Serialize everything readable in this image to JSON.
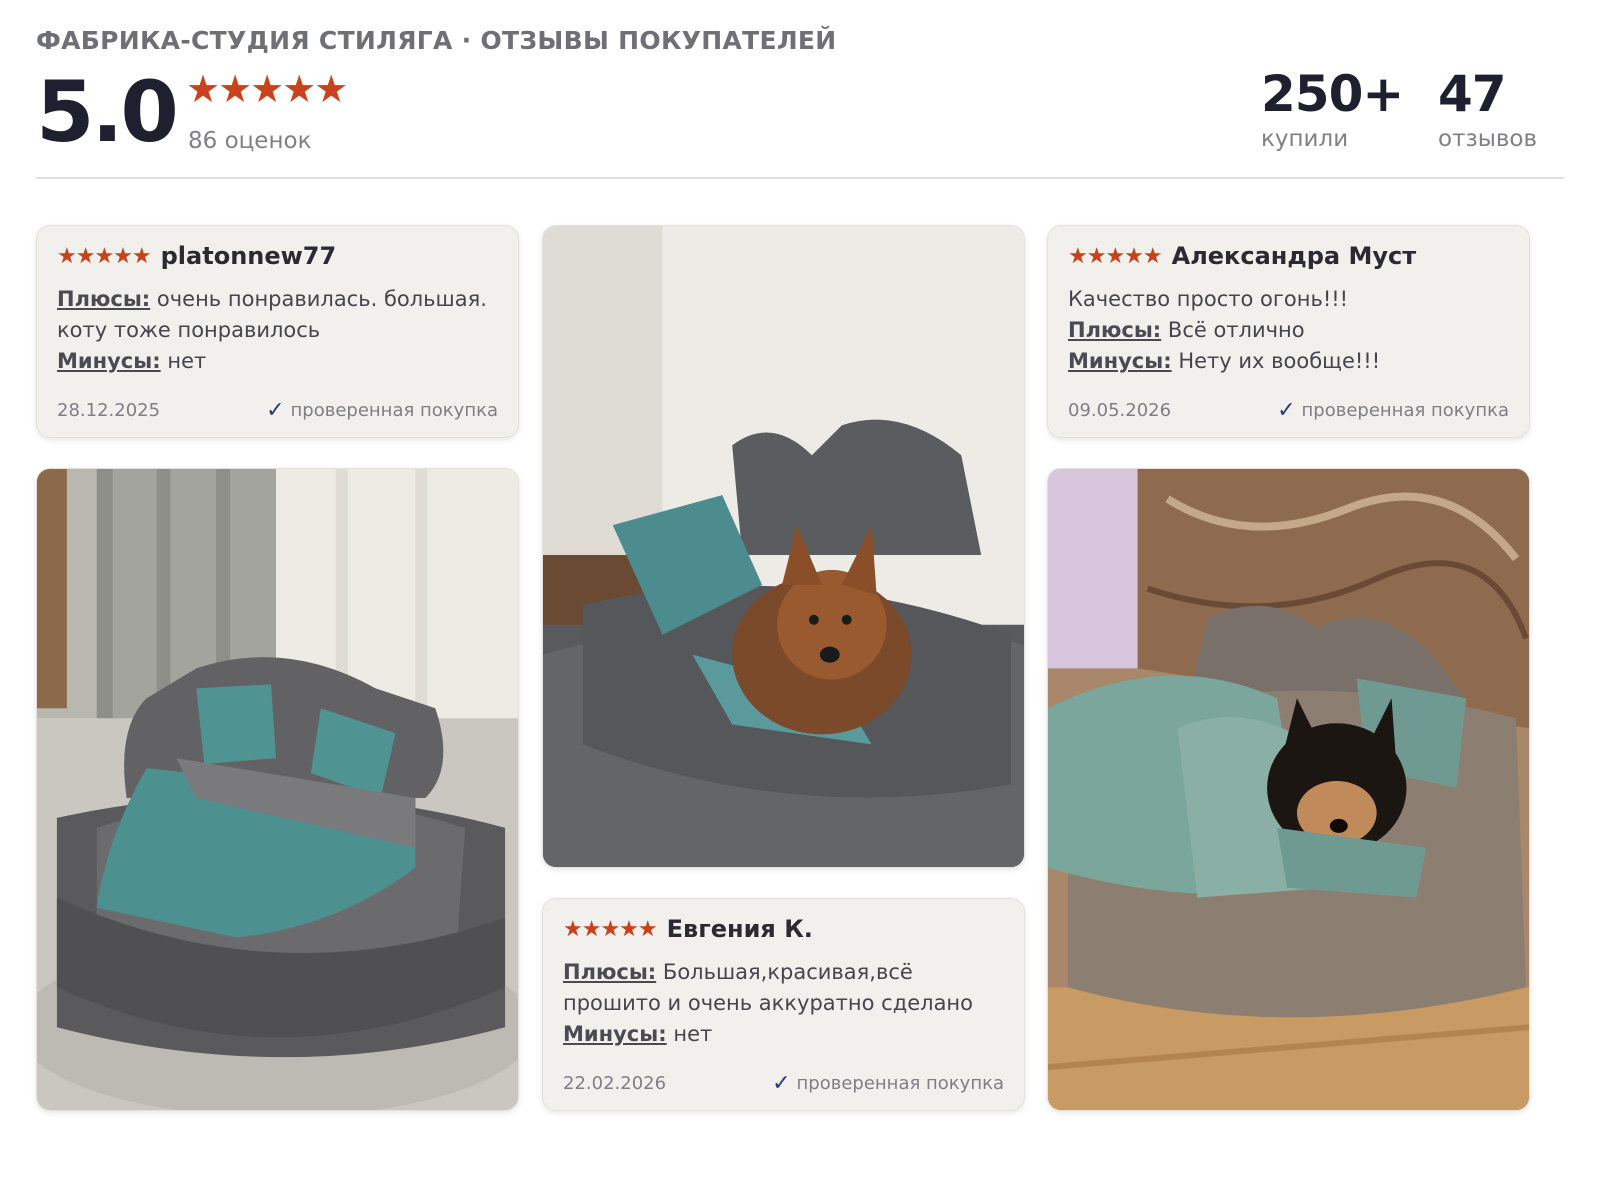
{
  "header": {
    "title": "ФАБРИКА-СТУДИЯ СТИЛЯГА · ОТЗЫВЫ ПОКУПАТЕЛЕЙ",
    "rating": "5.0",
    "stars": "★★★★★",
    "ratings_count": "86 оценок",
    "bought_value": "250+",
    "bought_label": "купили",
    "reviews_value": "47",
    "reviews_label": "отзывов"
  },
  "reviews": [
    {
      "stars": "★★★★★",
      "author": "platonnew77",
      "pros_label": "Плюсы:",
      "pros": "очень понравилась. большая. коту тоже понравилось",
      "cons_label": "Минусы:",
      "cons": "нет",
      "date": "28.12.2025",
      "verified": "проверенная покупка"
    },
    {
      "stars": "★★★★★",
      "author": "Евгения К.",
      "pros_label": "Плюсы:",
      "pros": "Большая,красивая,всё прошито и очень аккуратно сделано",
      "cons_label": "Минусы:",
      "cons": "нет",
      "date": "22.02.2026",
      "verified": "проверенная покупка"
    },
    {
      "stars": "★★★★★",
      "author": "Александра Муст",
      "comment": "Качество просто огонь!!!",
      "pros_label": "Плюсы:",
      "pros": "Всё отлично",
      "cons_label": "Минусы:",
      "cons": "Нету их вообще!!!",
      "date": "09.05.2026",
      "verified": "проверенная покупка"
    }
  ],
  "icons": {
    "star": "star-icon",
    "check": "check-icon"
  },
  "colors": {
    "accent_star": "#c8431c",
    "check": "#2d3a7a",
    "card_bg": "#f1f0ed",
    "title": "#1e2030"
  }
}
